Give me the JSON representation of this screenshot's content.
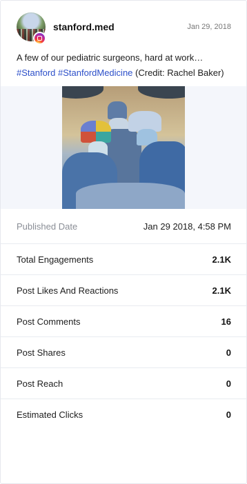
{
  "post": {
    "username": "stanford.med",
    "date": "Jan 29, 2018",
    "caption_text": "A few of our pediatric surgeons, hard at work…",
    "hashtags": [
      "#Stanford",
      "#StanfordMedicine"
    ],
    "credit": "(Credit: Rachel Baker)",
    "platform_icon": "instagram-icon"
  },
  "stats": {
    "published": {
      "label": "Published Date",
      "value": "Jan 29 2018, 4:58 PM"
    },
    "rows": [
      {
        "label": "Total Engagements",
        "value": "2.1K"
      },
      {
        "label": "Post Likes And Reactions",
        "value": "2.1K"
      },
      {
        "label": "Post Comments",
        "value": "16"
      },
      {
        "label": "Post Shares",
        "value": "0"
      },
      {
        "label": "Post Reach",
        "value": "0"
      },
      {
        "label": "Estimated Clicks",
        "value": "0"
      }
    ]
  },
  "colors": {
    "hashtag": "#2c4fc9",
    "media_background": "#f4f6fb",
    "divider": "#e8ebf0"
  }
}
